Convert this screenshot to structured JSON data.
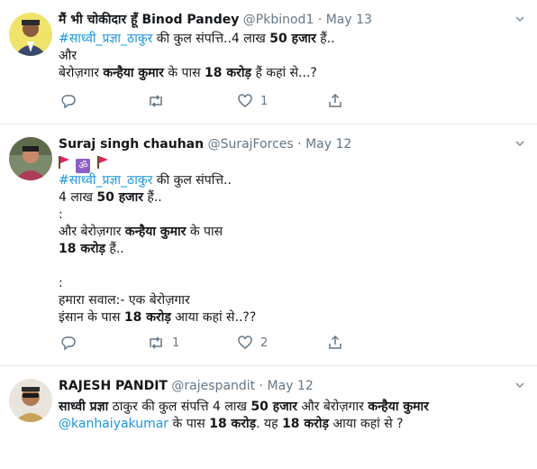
{
  "tweets": [
    {
      "name": "मैं भी चोकीदार हूँ Binod Pandey",
      "handle": "@Pkbinod1",
      "sep": "·",
      "date": "May 13",
      "lines": [
        [
          {
            "t": "#साध्वी_प्रज्ञा_ठाकुर",
            "c": "link"
          },
          {
            "t": " की कुल संपत्ति..4 लाख "
          },
          {
            "t": "50 हजार",
            "c": "b"
          },
          {
            "t": " हैं.."
          }
        ],
        [
          {
            "t": "और"
          }
        ],
        [
          {
            "t": " बेरोज़गार "
          },
          {
            "t": "कन्हैया कुमार",
            "c": "b"
          },
          {
            "t": " के पास "
          },
          {
            "t": "18 करोड़",
            "c": "b"
          },
          {
            "t": " हैं  कहां से...?"
          }
        ]
      ],
      "reply_count": "",
      "retweet_count": "",
      "like_count": "1"
    },
    {
      "name": "Suraj singh chauhan",
      "handle": "@SurajForces",
      "sep": "·",
      "date": "May 12",
      "emoji_line": "🚩🕉🚩",
      "om_glyph": "ॐ",
      "lines": [
        [
          {
            "t": "#साध्वी_प्रज्ञा_ठाकुर",
            "c": "link"
          },
          {
            "t": " की कुल संपत्ति.."
          }
        ],
        [
          {
            "t": "4 लाख "
          },
          {
            "t": "50 हजार",
            "c": "b"
          },
          {
            "t": " हैं.."
          }
        ],
        [
          {
            "t": ":"
          }
        ],
        [
          {
            "t": "और बेरोज़गार "
          },
          {
            "t": "कन्हैया कुमार",
            "c": "b"
          },
          {
            "t": " के पास"
          }
        ],
        [
          {
            "t": "18 करोड़",
            "c": "b"
          },
          {
            "t": " हैं.."
          }
        ],
        [
          {
            "t": ""
          }
        ],
        [
          {
            "t": ":"
          }
        ],
        [
          {
            "t": "हमारा सवाल:- एक बेरोज़गार"
          }
        ],
        [
          {
            "t": "इंसान के पास "
          },
          {
            "t": "18 करोड़",
            "c": "b"
          },
          {
            "t": " आया कहां से..??"
          }
        ]
      ],
      "reply_count": "",
      "retweet_count": "1",
      "like_count": "2"
    },
    {
      "name": "RAJESH PANDIT",
      "handle": "@rajespandit",
      "sep": "·",
      "date": "May 12",
      "lines": [
        [
          {
            "t": "साध्वी प्रज्ञा",
            "c": "b"
          },
          {
            "t": " ठाकुर की कुल संपत्ति 4 लाख "
          },
          {
            "t": "50 हजार",
            "c": "b"
          },
          {
            "t": " और बेरोज़गार "
          },
          {
            "t": "कन्हैया कुमार",
            "c": "b"
          }
        ],
        [
          {
            "t": "@kanhaiyakumar",
            "c": "link"
          },
          {
            "t": " के पास "
          },
          {
            "t": "18 करोड़",
            "c": "b"
          },
          {
            "t": ". यह "
          },
          {
            "t": "18 करोड़",
            "c": "b"
          },
          {
            "t": " आया कहां से ?"
          }
        ]
      ]
    }
  ],
  "colors": {
    "link": "#1b95e0",
    "meta": "#657786",
    "divider": "#e6ecf0",
    "flag": "#e0245e",
    "om": "#8e5fc7"
  },
  "icons": [
    "chevron-down-icon",
    "reply-icon",
    "retweet-icon",
    "like-icon",
    "share-icon"
  ]
}
